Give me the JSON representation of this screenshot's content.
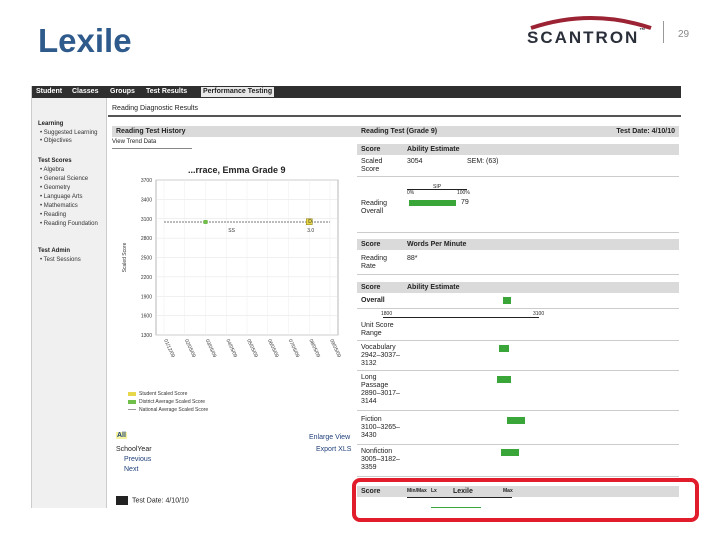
{
  "slide": {
    "title": "Lexile",
    "page_number": "29",
    "logo_text": "SCANTRON",
    "logo_mark": "™"
  },
  "tabs": [
    "Student",
    "Classes",
    "Groups",
    "Test Results",
    "Performance Testing"
  ],
  "header": {
    "title": "Reading Diagnostic Results"
  },
  "left_nav": {
    "learning": "Learning",
    "learning_items": [
      "Suggested Learning",
      "Objectives"
    ],
    "test_scores": "Test Scores",
    "score_items": [
      "Algebra",
      "General Science",
      "Geometry",
      "Language Arts",
      "Mathematics",
      "Reading",
      "Reading Foundation"
    ],
    "test_admin": "Test Admin",
    "admin_items": [
      "Test Sessions"
    ]
  },
  "history": {
    "header": "Reading Test History",
    "sub": "View Trend Data",
    "chart_title": "...rrace, Emma Grade 9",
    "all_link": "All",
    "enlarge": "Enlarge View",
    "export": "Export XLS",
    "school_year": "SchoolYear",
    "previous": "Previous",
    "next": "Next",
    "test_date": "Test Date: 4/10/10"
  },
  "chart_data": {
    "type": "line",
    "ylabel": "Scaled Score",
    "y_ticks": [
      "3700",
      "3400",
      "3100",
      "2800",
      "2500",
      "2200",
      "1900",
      "1600",
      "1300"
    ],
    "x_ticks": [
      "01/12/09",
      "02/05/09",
      "03/05/09",
      "04/05/09",
      "05/05/09",
      "06/05/09",
      "07/05/09",
      "08/05/09",
      "09/05/09"
    ],
    "ylim": [
      1300,
      3700
    ],
    "series": [
      {
        "name": "Student Scaled Score",
        "color": "#e6d84a",
        "x_index": [
          7
        ],
        "values": [
          3054
        ]
      },
      {
        "name": "District Average Scaled Score",
        "color": "#6fbf4a",
        "x_index": [
          2
        ],
        "values": [
          3050
        ]
      },
      {
        "name": "National Average Scaled Score",
        "color": "#9a9a9a",
        "x_index": [
          0,
          8
        ],
        "values": [
          3050,
          3050
        ]
      }
    ],
    "annotations": [
      "SS",
      "D",
      "3.0"
    ],
    "legend": "bottom-left"
  },
  "reading_test": {
    "header": "Reading Test (Grade 9)",
    "test_date": "Test Date: 4/10/10",
    "score_col": "Score",
    "ability_col": "Ability Estimate",
    "scaled_score_label": "Scaled\nScore",
    "scaled_score": "3054",
    "sem": "SEM: (63)",
    "scale_labels": [
      "0%",
      "SIP",
      "100%"
    ],
    "sip_value": 0.79,
    "sip_text": "79",
    "reading_overall_label": "Reading\nOverall",
    "wpm_score_col": "Score",
    "wpm_col": "Words Per Minute",
    "reading_rate_label": "Reading\nRate",
    "reading_rate": "88*",
    "ability_score_col": "Score",
    "ability_col2": "Ability Estimate",
    "overall_label": "Overall",
    "unit_score_label": "Unit Score\nRange",
    "range_low": "1800",
    "range_high": "3100",
    "vocab_label": "Vocabulary\n2942–3037–\n3132",
    "long_label": "Long\nPassage\n2890–3017–\n3144",
    "fiction_label": "Fiction\n3100–3265–\n3430",
    "nonfiction_label": "Nonfiction\n3005–3182–\n3359",
    "lexile_score_col": "Score",
    "lexile_col_1": "Min/Max",
    "lexile_col_2": "Lx",
    "lexile_col_3": "Lexile",
    "lexile_col_4": "Max"
  }
}
